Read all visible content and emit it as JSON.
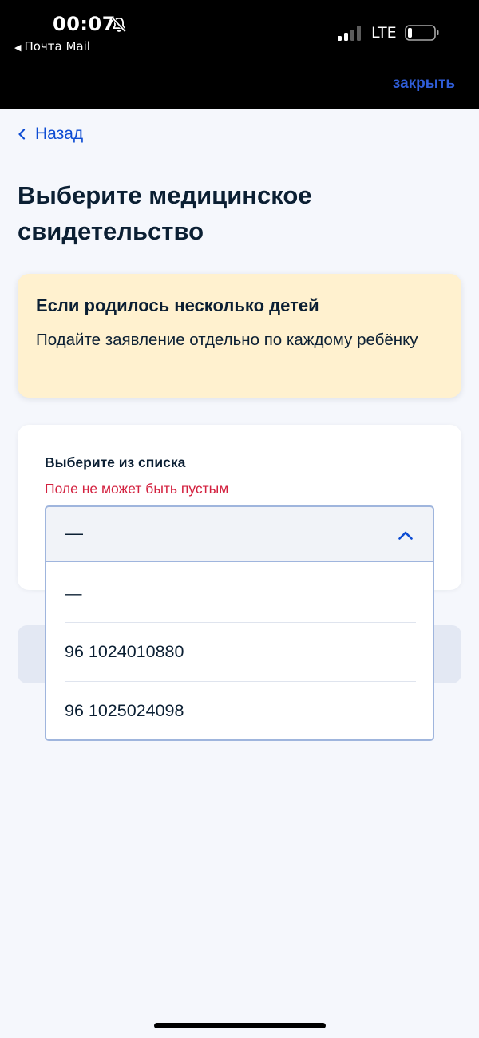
{
  "status_bar": {
    "time": "00:07",
    "back_app": "Почта Mail",
    "network": "LTE",
    "icons": [
      "bell-slash-icon",
      "signal-icon",
      "battery-icon"
    ]
  },
  "header": {
    "close_label": "закрыть"
  },
  "nav": {
    "back_label": "Назад"
  },
  "page": {
    "title": "Выберите медицинское свидетельство"
  },
  "warning": {
    "title": "Если родилось несколько детей",
    "text": "Подайте заявление отдельно по каждому ребёнку"
  },
  "form": {
    "label": "Выберите из списка",
    "error": "Поле не может быть пустым",
    "selected_value": "—",
    "options": [
      "—",
      "96 1024010880",
      "96 1025024098"
    ]
  },
  "colors": {
    "accent": "#0d4cd3",
    "error": "#d3213f",
    "warning_bg": "#fff1cf",
    "page_bg": "#f5f7fc"
  }
}
